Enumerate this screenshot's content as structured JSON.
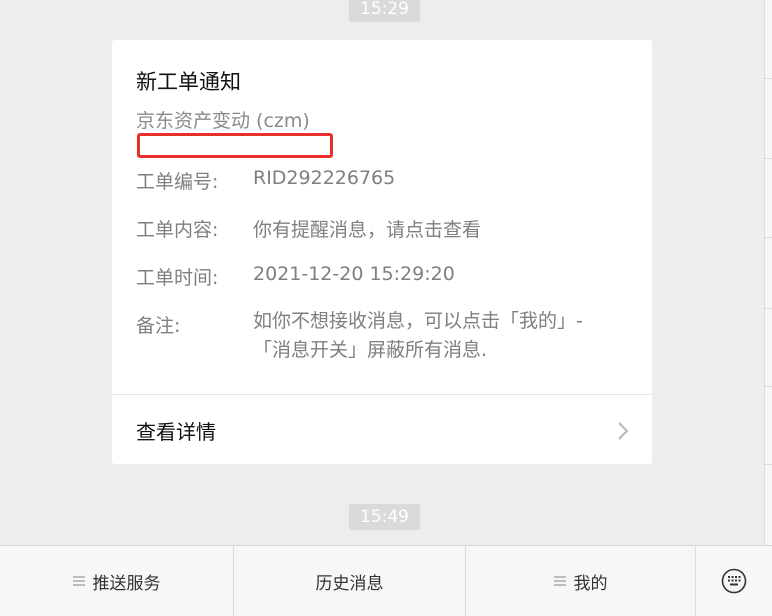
{
  "timestamps": {
    "first": "15:29",
    "second": "15:49"
  },
  "notification": {
    "title": "新工单通知",
    "subtitle": "京东资产变动 (czm)",
    "fields": [
      {
        "label": "工单编号:",
        "value": "RID292226765"
      },
      {
        "label": "工单内容:",
        "value": "你有提醒消息，请点击查看"
      },
      {
        "label": "工单时间:",
        "value": "2021-12-20 15:29:20"
      }
    ],
    "remark": {
      "label": "备注:",
      "line1": "如你不想接收消息，可以点击「我的」-",
      "line2": "「消息开关」屏蔽所有消息."
    },
    "detail_link": "查看详情",
    "redaction_color": "#e8302a"
  },
  "menu": {
    "items": [
      {
        "label": "推送服务",
        "has_submenu": true
      },
      {
        "label": "历史消息",
        "has_submenu": false
      },
      {
        "label": "我的",
        "has_submenu": true
      }
    ],
    "keyboard_icon": "keyboard-icon"
  }
}
